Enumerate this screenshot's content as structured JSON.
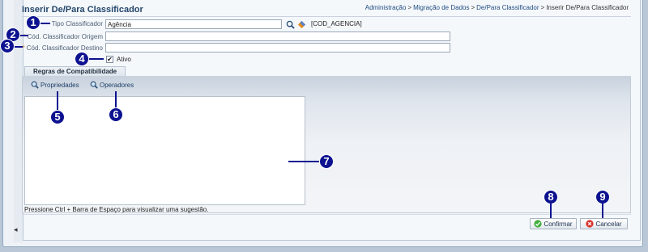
{
  "page": {
    "title": "Inserir De/Para Classificador",
    "breadcrumb": [
      "Administração",
      "Migração de Dados",
      "De/Para Classificador"
    ],
    "breadcrumb_current": "Inserir De/Para Classificador"
  },
  "form": {
    "tipo": {
      "label": "Tipo Classificador",
      "value": "Agência",
      "code": "[COD_AGENCIA]"
    },
    "origem": {
      "label": "Cód. Classificador Origem",
      "required": "*",
      "value": ""
    },
    "destino": {
      "label": "Cód. Classificador Destino",
      "required": "*",
      "value": ""
    },
    "ativo": {
      "label": "Ativo",
      "checked": "✔"
    }
  },
  "tabs": {
    "regras": "Regras de Compatibilidade"
  },
  "toolbar": {
    "propriedades": "Propriedades",
    "operadores": "Operadores"
  },
  "editor": {
    "value": "",
    "hint": "Pressione Ctrl + Barra de Espaço para visualizar uma sugestão."
  },
  "actions": {
    "confirmar": "Confirmar",
    "cancelar": "Cancelar"
  },
  "callouts": [
    "1",
    "2",
    "3",
    "4",
    "5",
    "6",
    "7",
    "8",
    "9"
  ],
  "colors": {
    "accent": "#24466b",
    "link": "#1f4b80",
    "callout": "#0d1290"
  }
}
